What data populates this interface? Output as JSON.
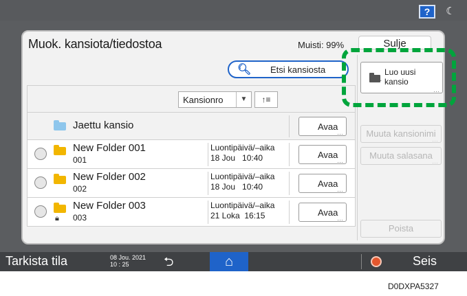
{
  "topbar": {
    "help_label": "?",
    "theme_icon": "moon-icon"
  },
  "dialog": {
    "title": "Muok. kansiota/tiedostoa",
    "memory": "Muisti: 99%",
    "close": "Sulje"
  },
  "search": {
    "label": "Etsi kansiosta",
    "icon": "search-icon"
  },
  "sort": {
    "selected": "Kansionro",
    "direction_icon": "sort-ascending-icon",
    "direction_label": "↑≡"
  },
  "rows": [
    {
      "name": "Jaettu kansio",
      "open": "Avaa"
    },
    {
      "name": "New Folder 001",
      "number": "001",
      "date_label": "Luontipäivä/–aika",
      "date": "18 Jou   10:40",
      "open": "Avaa"
    },
    {
      "name": "New Folder 002",
      "number": "002",
      "date_label": "Luontipäivä/–aika",
      "date": "18 Jou   10:40",
      "open": "Avaa"
    },
    {
      "name": "New Folder 003",
      "number": "003",
      "date_label": "Luontipäivä/–aika",
      "date": "21 Loka  16:15",
      "open": "Avaa",
      "locked": true
    }
  ],
  "actions": {
    "new_folder": "Luo uusi kansio",
    "rename": "Muuta kansionimi",
    "password": "Muuta salasana",
    "delete": "Poista"
  },
  "bottombar": {
    "check_status": "Tarkista tila",
    "date": "08 Jou. 2021",
    "time": "10 : 25",
    "back_icon": "back-arrow-icon",
    "home_icon": "home-icon",
    "stop_icon": "stop-icon",
    "stop": "Seis"
  },
  "caption": "D0DXPA5327",
  "colors": {
    "accent": "#1f63c9",
    "highlight": "#00a53c",
    "folder": "#f2b600",
    "shared_folder": "#8ec6ec"
  }
}
